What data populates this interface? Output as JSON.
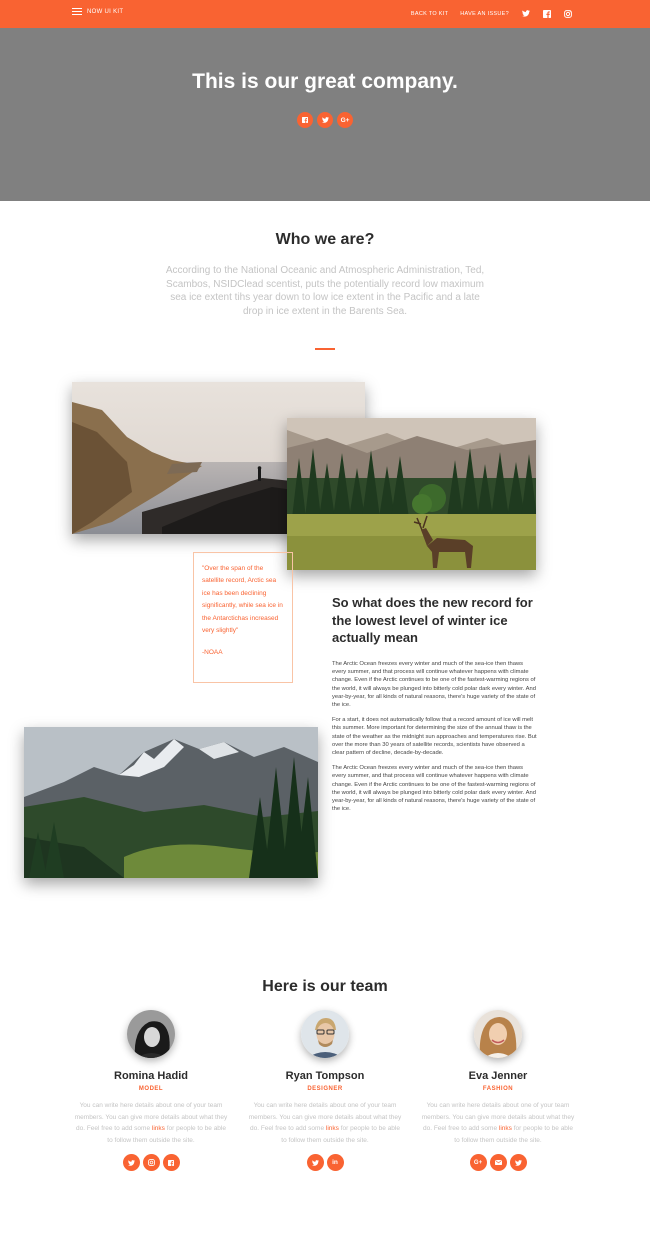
{
  "navbar": {
    "brand": "NOW UI KIT",
    "links": [
      "BACK TO KIT",
      "HAVE AN ISSUE?"
    ],
    "icons": [
      "twitter-icon",
      "facebook-icon",
      "instagram-icon"
    ]
  },
  "hero": {
    "title": "This is our great company.",
    "social_icons": [
      "facebook-icon",
      "twitter-icon",
      "google-plus-icon"
    ]
  },
  "about": {
    "title": "Who we are?",
    "description": "According to the National Oceanic and Atmospheric Administration, Ted, Scambos, NSIDClead scentist, puts the potentially record low maximum sea ice extent tihs year down to low ice extent in the Pacific and a late drop in ice extent in the Barents Sea."
  },
  "quote": {
    "text": "\"Over the span of the satellite record, Arctic sea ice has been declining significantly, while sea ice in the Antarctichas increased very slightly\"",
    "author": "-NOAA"
  },
  "article": {
    "title": "So what does the new record for the lowest level of winter ice actually mean",
    "paragraphs": [
      "The Arctic Ocean freezes every winter and much of the sea-ice then thaws every summer, and that process will continue whatever happens with climate change. Even if the Arctic continues to be one of the fastest-warming regions of the world, it will always be plunged into bitterly cold polar dark every winter. And year-by-year, for all kinds of natural reasons, there's huge variety of the state of the ice.",
      "For a start, it does not automatically follow that a record amount of ice will melt this summer. More important for determining the size of the annual thaw is the state of the weather as the midnight sun approaches and temperatures rise. But over the more than 30 years of satellite records, scientists have observed a clear pattern of decline, decade-by-decade.",
      "The Arctic Ocean freezes every winter and much of the sea-ice then thaws every summer, and that process will continue whatever happens with climate change. Even if the Arctic continues to be one of the fastest-warming regions of the world, it will always be plunged into bitterly cold polar dark every winter. And year-by-year, for all kinds of natural reasons, there's huge variety of the state of the ice."
    ]
  },
  "team": {
    "title": "Here is our team",
    "members": [
      {
        "name": "Romina Hadid",
        "role": "MODEL",
        "desc_before": "You can write here details about one of your team members. You can give more details about what they do. Feel free to add some ",
        "link": "links",
        "desc_after": " for people to be able to follow them outside the site.",
        "social_icons": [
          "twitter-icon",
          "instagram-icon",
          "facebook-icon"
        ]
      },
      {
        "name": "Ryan Tompson",
        "role": "DESIGNER",
        "desc_before": "You can write here details about one of your team members. You can give more details about what they do. Feel free to add some ",
        "link": "links",
        "desc_after": " for people to be able to follow them outside the site.",
        "social_icons": [
          "twitter-icon",
          "linkedin-icon"
        ]
      },
      {
        "name": "Eva Jenner",
        "role": "FASHION",
        "desc_before": "You can write here details about one of your team members. You can give more details about what they do. Feel free to add some ",
        "link": "links",
        "desc_after": " for people to be able to follow them outside the site.",
        "social_icons": [
          "google-plus-icon",
          "email-icon",
          "twitter-icon"
        ]
      }
    ]
  },
  "colors": {
    "primary": "#f96332",
    "hero_bg": "#808080",
    "muted_text": "#c4c4c4"
  }
}
